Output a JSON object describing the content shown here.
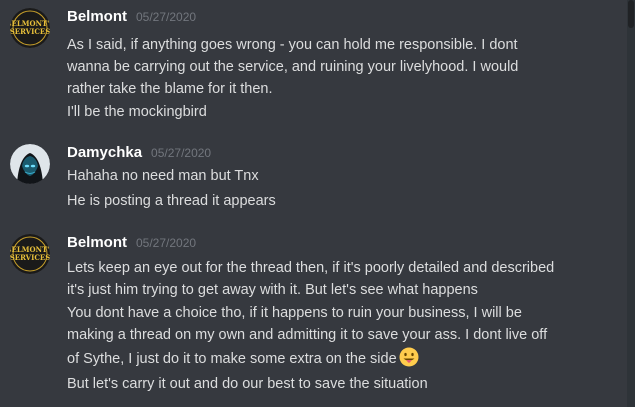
{
  "messages": [
    {
      "username": "Belmont",
      "timestamp": "05/27/2020",
      "avatar": "belmonts-services-logo",
      "avatar_text": "BELMONT'S SERVICES",
      "lines": [
        "As I said, if anything goes wrong - you can hold me responsible. I dont",
        "wanna be carrying out the service, and ruining your livelyhood. I would",
        "rather take the blame for it then.",
        "I'll be the mockingbird"
      ]
    },
    {
      "username": "Damychka",
      "timestamp": "05/27/2020",
      "avatar": "hooded-figure-avatar",
      "lines": [
        "Hahaha no need man but Tnx",
        "He is posting a thread it appears"
      ]
    },
    {
      "username": "Belmont",
      "timestamp": "05/27/2020",
      "avatar": "belmonts-services-logo",
      "avatar_text": "BELMONT'S SERVICES",
      "lines": [
        "Lets keep an eye out for the thread then, if it's poorly detailed and described",
        "it's just him trying to get away with it. But let's see what happens",
        "You dont have a choice tho, if it happens to ruin your business, I will be",
        "making a thread on my own and admitting it to save your ass. I dont live off",
        "of Sythe, I just do it to make some extra on the side",
        "But let's carry it out and do our best to save the situation"
      ],
      "emoji": "tongue-out-emoji"
    }
  ],
  "colors": {
    "background": "#36393f",
    "username": "#ffffff",
    "timestamp": "#72767d",
    "message_text": "#dcddde"
  }
}
